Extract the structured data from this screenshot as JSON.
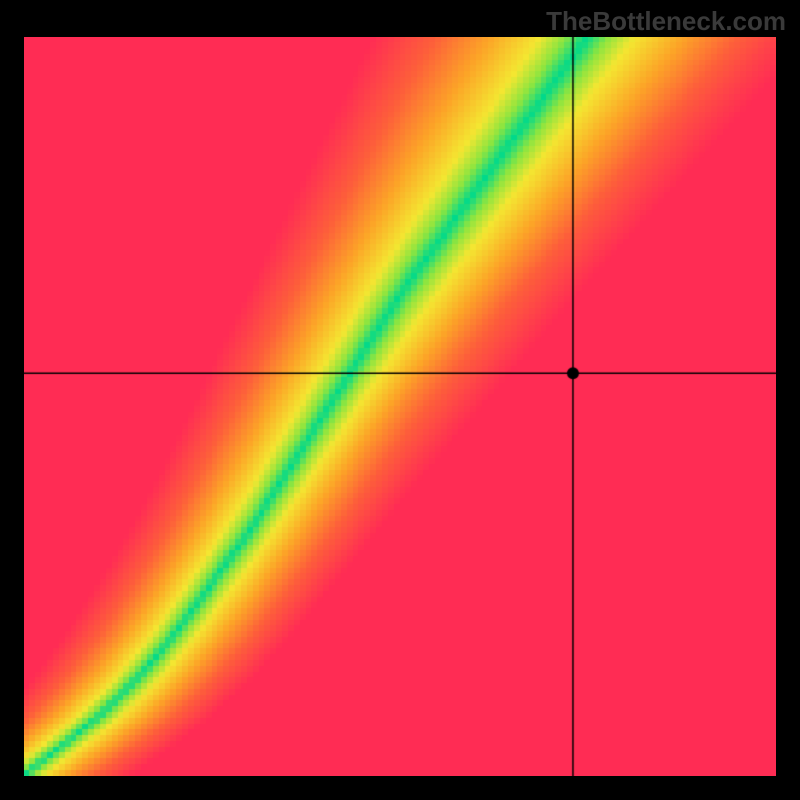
{
  "watermark": "TheBottleneck.com",
  "chart_data": {
    "type": "heatmap",
    "title": "",
    "xlabel": "",
    "ylabel": "",
    "xlim": [
      0,
      1
    ],
    "ylim": [
      0,
      1
    ],
    "crosshair": {
      "x": 0.73,
      "y": 0.545
    },
    "marker": {
      "x": 0.73,
      "y": 0.545,
      "radius": 6
    },
    "ridge_curve": {
      "description": "Optimal balance curve where gradient is green (score ≈ 0)",
      "points": [
        [
          0.0,
          0.0
        ],
        [
          0.05,
          0.04
        ],
        [
          0.1,
          0.08
        ],
        [
          0.15,
          0.13
        ],
        [
          0.2,
          0.19
        ],
        [
          0.25,
          0.26
        ],
        [
          0.3,
          0.33
        ],
        [
          0.35,
          0.41
        ],
        [
          0.4,
          0.49
        ],
        [
          0.45,
          0.57
        ],
        [
          0.5,
          0.65
        ],
        [
          0.55,
          0.72
        ],
        [
          0.6,
          0.79
        ],
        [
          0.65,
          0.86
        ],
        [
          0.7,
          0.93
        ],
        [
          0.75,
          1.0
        ]
      ]
    },
    "colormap": {
      "name": "red-orange-yellow-green",
      "stops": [
        {
          "value": 0.0,
          "color": "#00d98b"
        },
        {
          "value": 0.1,
          "color": "#8ee53f"
        },
        {
          "value": 0.22,
          "color": "#f4e631"
        },
        {
          "value": 0.45,
          "color": "#fca427"
        },
        {
          "value": 0.7,
          "color": "#fd5f3a"
        },
        {
          "value": 1.0,
          "color": "#ff2c54"
        }
      ]
    },
    "pixel_resolution": 128
  }
}
